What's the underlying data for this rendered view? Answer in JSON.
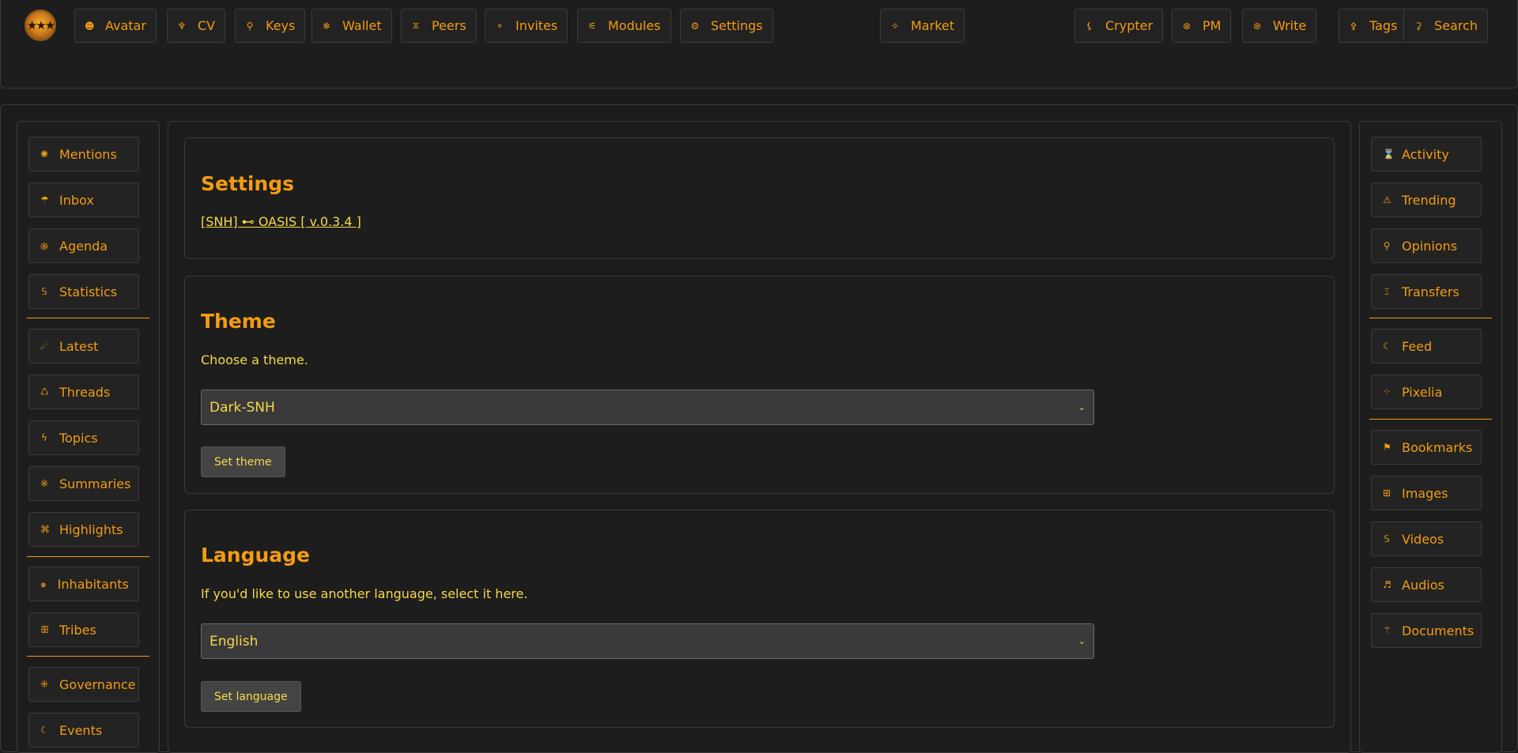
{
  "logo": {
    "glyph": "★★★"
  },
  "topnav": [
    {
      "id": "avatar",
      "icon": "☻",
      "label": "Avatar"
    },
    {
      "id": "cv",
      "icon": "♆",
      "label": "CV"
    },
    {
      "id": "keys",
      "icon": "⚲",
      "label": "Keys"
    },
    {
      "id": "wallet",
      "icon": "❄",
      "label": "Wallet"
    },
    {
      "id": "peers",
      "icon": "⧖",
      "label": "Peers"
    },
    {
      "id": "invites",
      "icon": "⚬",
      "label": "Invites"
    },
    {
      "id": "modules",
      "icon": "⚟",
      "label": "Modules"
    },
    {
      "id": "settings",
      "icon": "⚙",
      "label": "Settings"
    },
    {
      "id": "market",
      "icon": "✧",
      "label": "Market"
    },
    {
      "id": "crypter",
      "icon": "⚸",
      "label": "Crypter"
    },
    {
      "id": "pm",
      "icon": "⊗",
      "label": "PM"
    },
    {
      "id": "write",
      "icon": "⊛",
      "label": "Write"
    },
    {
      "id": "tags",
      "icon": "⚴",
      "label": "Tags"
    },
    {
      "id": "search",
      "icon": "⚳",
      "label": "Search"
    }
  ],
  "leftnav": [
    {
      "id": "mentions",
      "icon": "✺",
      "label": "Mentions"
    },
    {
      "id": "inbox",
      "icon": "☂",
      "label": "Inbox"
    },
    {
      "id": "agenda",
      "icon": "֎",
      "label": "Agenda"
    },
    {
      "id": "statistics",
      "icon": "𝕊",
      "label": "Statistics"
    },
    {
      "id": "latest",
      "icon": "☄",
      "label": "Latest"
    },
    {
      "id": "threads",
      "icon": "♺",
      "label": "Threads"
    },
    {
      "id": "topics",
      "icon": "ϟ",
      "label": "Topics"
    },
    {
      "id": "summaries",
      "icon": "※",
      "label": "Summaries"
    },
    {
      "id": "highlights",
      "icon": "⌘",
      "label": "Highlights"
    },
    {
      "id": "inhabitants",
      "icon": "๑",
      "label": "Inhabitants"
    },
    {
      "id": "tribes",
      "icon": "ꕥ",
      "label": "Tribes"
    },
    {
      "id": "governance",
      "icon": "⁜",
      "label": "Governance"
    },
    {
      "id": "events",
      "icon": "☾",
      "label": "Events"
    }
  ],
  "rightnav": [
    {
      "id": "activity",
      "icon": "⌛",
      "label": "Activity"
    },
    {
      "id": "trending",
      "icon": "⚠",
      "label": "Trending"
    },
    {
      "id": "opinions",
      "icon": "⚲",
      "label": "Opinions"
    },
    {
      "id": "transfers",
      "icon": "⌶",
      "label": "Transfers"
    },
    {
      "id": "feed",
      "icon": "☾",
      "label": "Feed"
    },
    {
      "id": "pixelia",
      "icon": "⁘",
      "label": "Pixelia"
    },
    {
      "id": "bookmarks",
      "icon": "⚑",
      "label": "Bookmarks"
    },
    {
      "id": "images",
      "icon": "⊞",
      "label": "Images"
    },
    {
      "id": "videos",
      "icon": "𝕊",
      "label": "Videos"
    },
    {
      "id": "audios",
      "icon": "♬",
      "label": "Audios"
    },
    {
      "id": "documents",
      "icon": "⚚",
      "label": "Documents"
    }
  ],
  "settings": {
    "title": "Settings",
    "version_link": "[SNH] ⊷ OASIS [ v.0.3.4 ]"
  },
  "theme": {
    "title": "Theme",
    "description": "Choose a theme.",
    "selected": "Dark-SNH",
    "button": "Set theme"
  },
  "language": {
    "title": "Language",
    "description": "If you'd like to use another language, select it here.",
    "selected": "English",
    "button": "Set language"
  },
  "colors": {
    "accent": "#f39c12",
    "text": "#f5d94a",
    "background": "#1b1b1b"
  }
}
